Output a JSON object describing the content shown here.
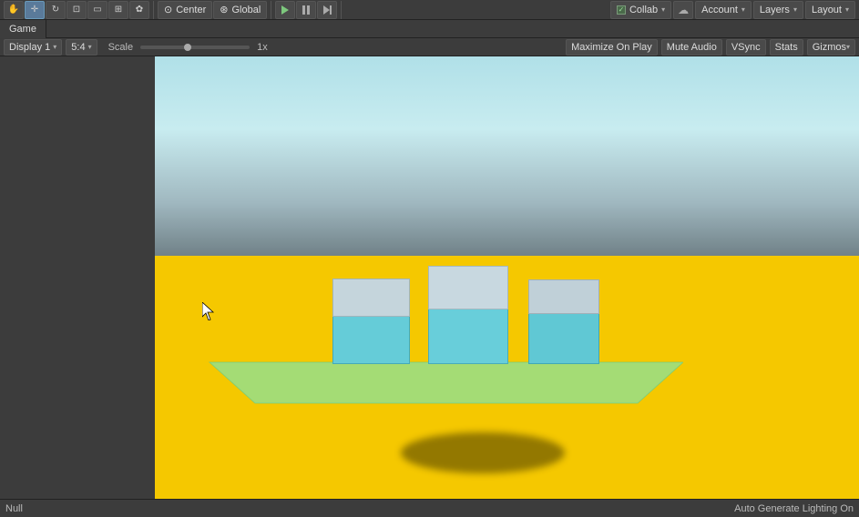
{
  "toolbar": {
    "tools": [
      {
        "id": "hand",
        "label": "✋",
        "active": false
      },
      {
        "id": "move",
        "label": "✛",
        "active": false
      },
      {
        "id": "rotate-cycle",
        "label": "↻",
        "active": false
      },
      {
        "id": "scale-tool",
        "label": "⊡",
        "active": false
      },
      {
        "id": "rect",
        "label": "▭",
        "active": false
      },
      {
        "id": "transform",
        "label": "⊞",
        "active": false
      },
      {
        "id": "custom",
        "label": "✿",
        "active": false
      }
    ],
    "center_dropdown": "Center",
    "global_dropdown": "Global",
    "play_label": "Play",
    "pause_label": "Pause",
    "step_label": "Step",
    "collab_label": "Collab",
    "cloud_label": "Cloud",
    "account_label": "Account",
    "layers_label": "Layers",
    "layout_label": "Layout"
  },
  "game_panel": {
    "tab_label": "Game",
    "display_label": "Display 1",
    "aspect_label": "5:4",
    "scale_label": "Scale",
    "scale_value": "1x",
    "maximize_label": "Maximize On Play",
    "mute_label": "Mute Audio",
    "vsync_label": "VSync",
    "stats_label": "Stats",
    "gizmos_label": "Gizmos"
  },
  "status_bar": {
    "left_text": "Null",
    "right_text": "Auto Generate Lighting On"
  }
}
